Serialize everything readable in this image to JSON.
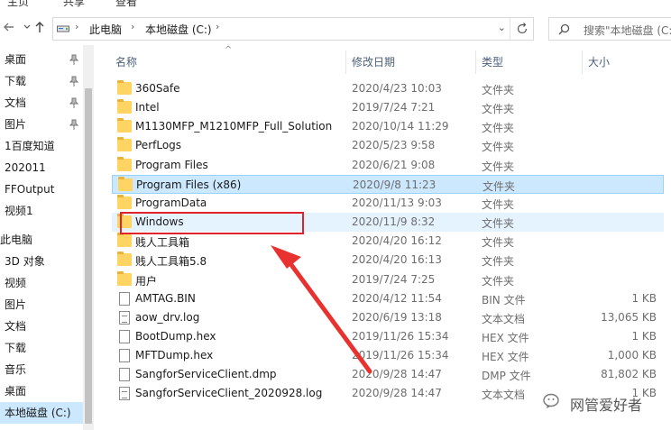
{
  "ribbon": {
    "tabs": [
      "主页",
      "共享",
      "查看"
    ]
  },
  "address": {
    "crumbs": [
      "此电脑",
      "本地磁盘 (C:)"
    ],
    "search_placeholder": "搜索\"本地磁盘 (C:)\""
  },
  "sidebar": {
    "items": [
      {
        "label": "桌面",
        "pinned": true
      },
      {
        "label": "下载",
        "pinned": true
      },
      {
        "label": "文档",
        "pinned": true
      },
      {
        "label": "图片",
        "pinned": true
      },
      {
        "label": "1百度知道",
        "pinned": false
      },
      {
        "label": "202011",
        "pinned": false
      },
      {
        "label": "FFOutput",
        "pinned": false
      },
      {
        "label": "视频1",
        "pinned": false
      },
      {
        "label": "此电脑",
        "pinned": false,
        "section": true
      },
      {
        "label": "3D 对象",
        "pinned": false
      },
      {
        "label": "视频",
        "pinned": false
      },
      {
        "label": "图片",
        "pinned": false
      },
      {
        "label": "文档",
        "pinned": false
      },
      {
        "label": "下载",
        "pinned": false
      },
      {
        "label": "音乐",
        "pinned": false
      },
      {
        "label": "桌面",
        "pinned": false
      },
      {
        "label": "本地磁盘 (C:)",
        "pinned": false,
        "selected": true
      }
    ]
  },
  "columns": {
    "name": "名称",
    "date": "修改日期",
    "type": "类型",
    "size": "大小"
  },
  "files": [
    {
      "name": "360Safe",
      "date": "2020/4/23 10:03",
      "type": "文件夹",
      "size": "",
      "kind": "folder"
    },
    {
      "name": "Intel",
      "date": "2019/7/24 7:21",
      "type": "文件夹",
      "size": "",
      "kind": "folder"
    },
    {
      "name": "M1130MFP_M1210MFP_Full_Solution",
      "date": "2020/10/14 11:29",
      "type": "文件夹",
      "size": "",
      "kind": "folder"
    },
    {
      "name": "PerfLogs",
      "date": "2020/5/23 9:58",
      "type": "文件夹",
      "size": "",
      "kind": "folder"
    },
    {
      "name": "Program Files",
      "date": "2020/6/21 9:08",
      "type": "文件夹",
      "size": "",
      "kind": "folder"
    },
    {
      "name": "Program Files (x86)",
      "date": "2020/9/8 11:23",
      "type": "文件夹",
      "size": "",
      "kind": "folder",
      "state": "selected"
    },
    {
      "name": "ProgramData",
      "date": "2020/11/13 9:03",
      "type": "文件夹",
      "size": "",
      "kind": "folder"
    },
    {
      "name": "Windows",
      "date": "2020/11/9 8:32",
      "type": "文件夹",
      "size": "",
      "kind": "folder",
      "state": "hover"
    },
    {
      "name": "贱人工具箱",
      "date": "2020/4/20 16:12",
      "type": "文件夹",
      "size": "",
      "kind": "folder"
    },
    {
      "name": "贱人工具箱5.8",
      "date": "2020/4/20 16:13",
      "type": "文件夹",
      "size": "",
      "kind": "folder"
    },
    {
      "name": "用户",
      "date": "2019/7/24 7:25",
      "type": "文件夹",
      "size": "",
      "kind": "folder"
    },
    {
      "name": "AMTAG.BIN",
      "date": "2020/4/12 11:54",
      "type": "BIN 文件",
      "size": "1 KB",
      "kind": "file"
    },
    {
      "name": "aow_drv.log",
      "date": "2020/6/19 13:18",
      "type": "文本文档",
      "size": "13,065 KB",
      "kind": "text"
    },
    {
      "name": "BootDump.hex",
      "date": "2019/11/26 15:34",
      "type": "HEX 文件",
      "size": "1 KB",
      "kind": "file"
    },
    {
      "name": "MFTDump.hex",
      "date": "2019/11/26 15:34",
      "type": "HEX 文件",
      "size": "1,000 KB",
      "kind": "file"
    },
    {
      "name": "SangforServiceClient.dmp",
      "date": "2020/9/28 14:47",
      "type": "DMP 文件",
      "size": "81,802 KB",
      "kind": "file"
    },
    {
      "name": "SangforServiceClient_2020928.log",
      "date": "2020/9/28 14:47",
      "type": "文本文档",
      "size": "1 KB",
      "kind": "text"
    }
  ],
  "watermark": {
    "text": "网管爱好者"
  },
  "colors": {
    "selection": "#cce8ff",
    "annotation": "#e0232e",
    "folder": "#ffd463"
  }
}
